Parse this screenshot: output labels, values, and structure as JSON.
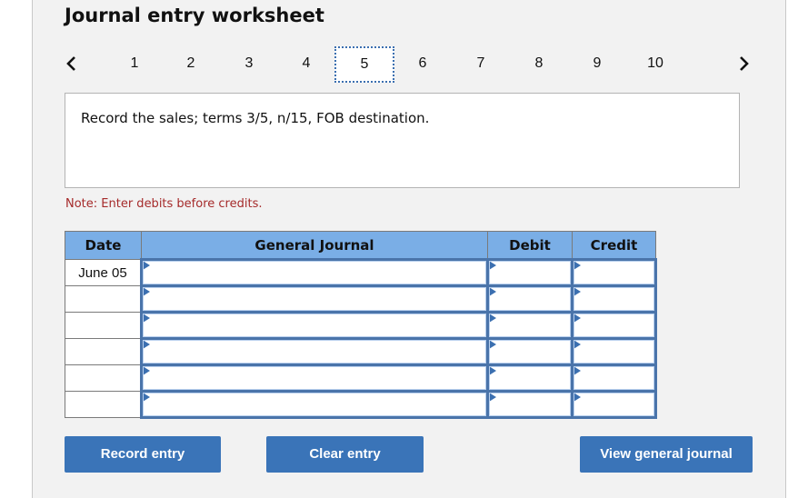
{
  "title": "Journal entry worksheet",
  "pager": {
    "prev_icon": "‹",
    "next_icon": "›",
    "pages": [
      "1",
      "2",
      "3",
      "4",
      "5",
      "6",
      "7",
      "8",
      "9",
      "10"
    ],
    "active_page": "5"
  },
  "question": "Record the sales; terms 3/5, n/15, FOB destination.",
  "note": "Note: Enter debits before credits.",
  "table": {
    "headers": {
      "date": "Date",
      "general_journal": "General Journal",
      "debit": "Debit",
      "credit": "Credit"
    },
    "rows": [
      {
        "date": "June 05",
        "account": "",
        "debit": "",
        "credit": ""
      },
      {
        "date": "",
        "account": "",
        "debit": "",
        "credit": ""
      },
      {
        "date": "",
        "account": "",
        "debit": "",
        "credit": ""
      },
      {
        "date": "",
        "account": "",
        "debit": "",
        "credit": ""
      },
      {
        "date": "",
        "account": "",
        "debit": "",
        "credit": ""
      },
      {
        "date": "",
        "account": "",
        "debit": "",
        "credit": ""
      }
    ]
  },
  "buttons": {
    "record": "Record entry",
    "clear": "Clear entry",
    "view": "View general journal"
  },
  "colors": {
    "accent": "#3a74b8",
    "header_bg": "#7aaee6",
    "note": "#a52a2a"
  }
}
